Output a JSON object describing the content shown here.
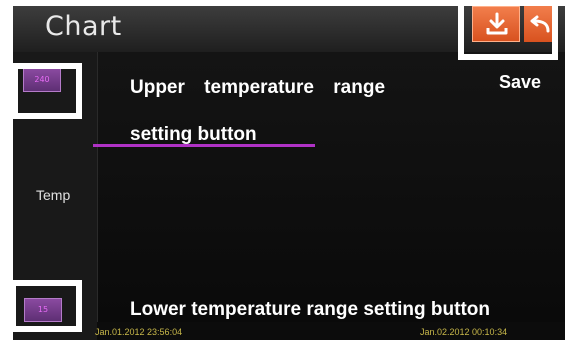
{
  "header": {
    "title": "Chart"
  },
  "toolbar": {
    "save_icon": "download-icon",
    "back_icon": "return-arrow-icon",
    "accent_color": "#e8622d"
  },
  "range_buttons": {
    "upper_value": "240",
    "lower_value": "15"
  },
  "axis": {
    "y_label": "Temp"
  },
  "timestamps": {
    "start": "Jan.01.2012 23:56:04",
    "end": "Jan.02.2012 00:10:34"
  },
  "series": {
    "color": "#b032c6"
  },
  "annotations": {
    "upper_line1": "Upper temperature range",
    "upper_line2": "setting button",
    "save": "Save",
    "lower": "Lower temperature range setting button"
  }
}
